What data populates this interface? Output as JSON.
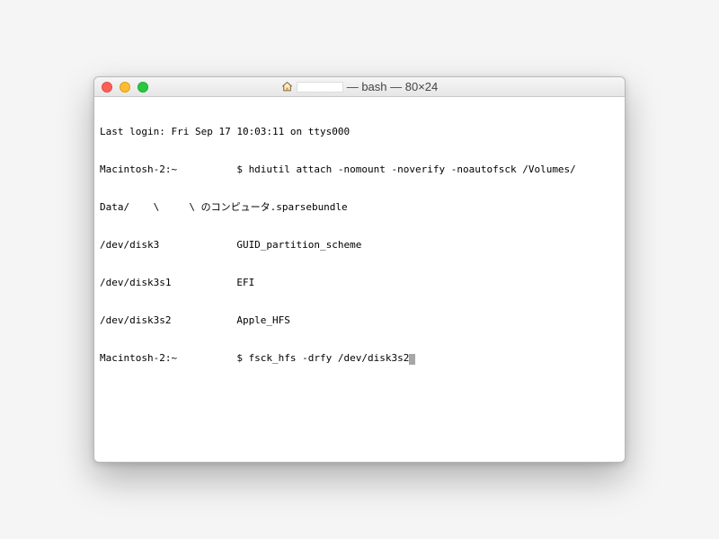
{
  "window": {
    "title_suffix": " — bash — 80×24"
  },
  "terminal": {
    "lines": [
      "Last login: Fri Sep 17 10:03:11 on ttys000",
      "Macintosh-2:~          $ hdiutil attach -nomount -noverify -noautofsck /Volumes/",
      "Data/    \\     \\ のコンピュータ.sparsebundle",
      "/dev/disk3             GUID_partition_scheme",
      "/dev/disk3s1           EFI",
      "/dev/disk3s2           Apple_HFS",
      "Macintosh-2:~          $ fsck_hfs -drfy /dev/disk3s2"
    ]
  }
}
